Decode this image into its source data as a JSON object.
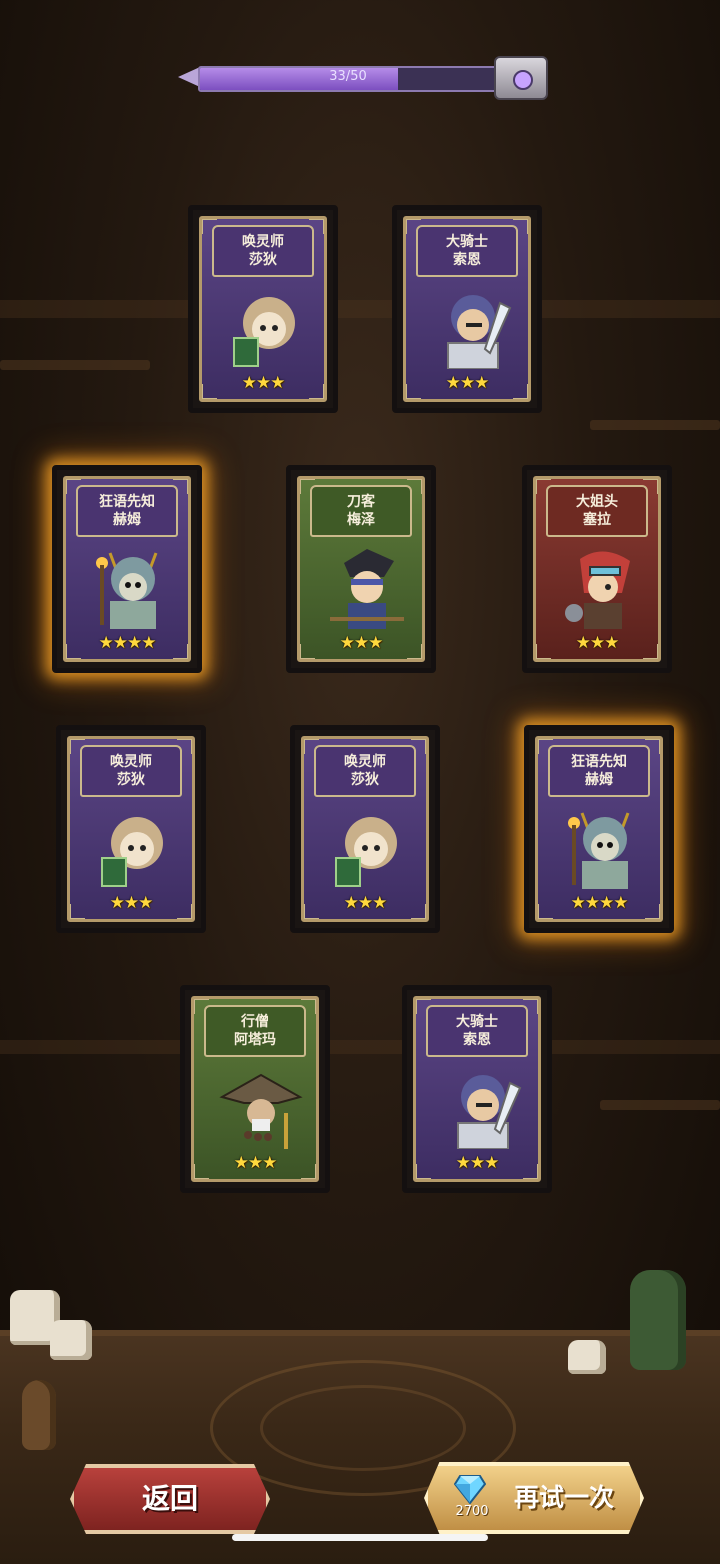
{
  "progress": {
    "text": "33/50",
    "value": 33,
    "max": 50
  },
  "cards": [
    {
      "title_line1": "唤灵师",
      "title_line2": "莎狄",
      "stars": "★★★",
      "star_count": 3,
      "theme": "purple",
      "glow": false,
      "portrait": "necromancer-portrait-icon"
    },
    {
      "title_line1": "大骑士",
      "title_line2": "索恩",
      "stars": "★★★",
      "star_count": 3,
      "theme": "purple",
      "glow": false,
      "portrait": "knight-portrait-icon"
    },
    {
      "title_line1": "狂语先知",
      "title_line2": "赫姆",
      "stars": "★★★★",
      "star_count": 4,
      "theme": "purple",
      "glow": true,
      "portrait": "prophet-portrait-icon"
    },
    {
      "title_line1": "刀客",
      "title_line2": "梅泽",
      "stars": "★★★",
      "star_count": 3,
      "theme": "green",
      "glow": false,
      "portrait": "swordsman-portrait-icon"
    },
    {
      "title_line1": "大姐头",
      "title_line2": "塞拉",
      "stars": "★★★",
      "star_count": 3,
      "theme": "red",
      "glow": false,
      "portrait": "boss-girl-portrait-icon"
    },
    {
      "title_line1": "唤灵师",
      "title_line2": "莎狄",
      "stars": "★★★",
      "star_count": 3,
      "theme": "purple",
      "glow": false,
      "portrait": "necromancer-portrait-icon"
    },
    {
      "title_line1": "唤灵师",
      "title_line2": "莎狄",
      "stars": "★★★",
      "star_count": 3,
      "theme": "purple",
      "glow": false,
      "portrait": "necromancer-portrait-icon"
    },
    {
      "title_line1": "狂语先知",
      "title_line2": "赫姆",
      "stars": "★★★★",
      "star_count": 4,
      "theme": "purple",
      "glow": true,
      "portrait": "prophet-portrait-icon"
    },
    {
      "title_line1": "行僧",
      "title_line2": "阿塔玛",
      "stars": "★★★",
      "star_count": 3,
      "theme": "green",
      "glow": false,
      "portrait": "monk-portrait-icon"
    },
    {
      "title_line1": "大骑士",
      "title_line2": "索恩",
      "stars": "★★★",
      "star_count": 3,
      "theme": "purple",
      "glow": false,
      "portrait": "knight-portrait-icon"
    }
  ],
  "buttons": {
    "back_label": "返回",
    "retry_label": "再试一次",
    "retry_cost": "2700",
    "retry_icon": "diamond-icon"
  },
  "colors": {
    "purple": "#4a3470",
    "green": "#3f5a26",
    "red": "#6e2a22",
    "star": "#ffd83d",
    "glow": "#ffaa28"
  }
}
